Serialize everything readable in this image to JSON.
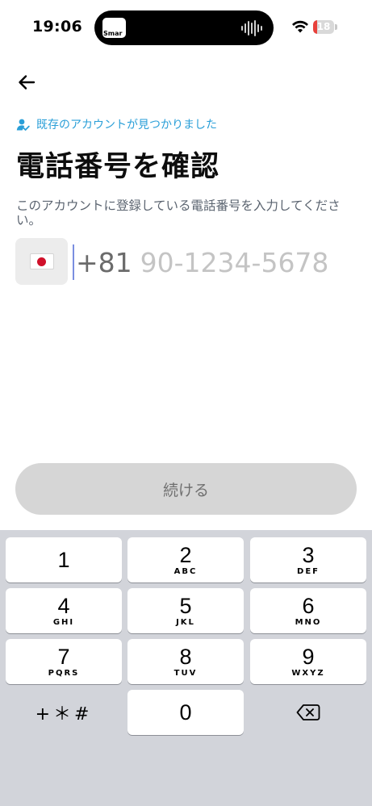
{
  "status_bar": {
    "time": "19:06",
    "island_app_label": "Smar",
    "battery_level": "18",
    "battery_fraction": 0.18
  },
  "header": {
    "back_icon": "arrow-left-icon"
  },
  "notice": {
    "icon": "user-check-icon",
    "text": "既存のアカウントが見つかりました",
    "color": "#2a9fd8"
  },
  "page": {
    "title": "電話番号を確認",
    "description": "このアカウントに登録している電話番号を入力してください。"
  },
  "phone": {
    "country_flag": "Japan flag",
    "prefix": "+81",
    "value": "",
    "placeholder": "90-1234-5678"
  },
  "continue_button": {
    "label": "続ける"
  },
  "keypad": {
    "keys": [
      {
        "digit": "1",
        "letters": ""
      },
      {
        "digit": "2",
        "letters": "ABC"
      },
      {
        "digit": "3",
        "letters": "DEF"
      },
      {
        "digit": "4",
        "letters": "GHI"
      },
      {
        "digit": "5",
        "letters": "JKL"
      },
      {
        "digit": "6",
        "letters": "MNO"
      },
      {
        "digit": "7",
        "letters": "PQRS"
      },
      {
        "digit": "8",
        "letters": "TUV"
      },
      {
        "digit": "9",
        "letters": "WXYZ"
      }
    ],
    "symbols_label": "+＊#",
    "zero": "0",
    "delete_icon": "backspace-icon"
  }
}
